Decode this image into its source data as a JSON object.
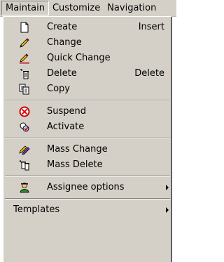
{
  "menubar": {
    "items": [
      {
        "label": "Maintain",
        "active": true
      },
      {
        "label": "Customize"
      },
      {
        "label": "Navigation"
      }
    ]
  },
  "menu": {
    "create": {
      "label": "Create",
      "shortcut": "Insert",
      "icon": "new-document-icon"
    },
    "change": {
      "label": "Change",
      "icon": "pencil-icon"
    },
    "quick_change": {
      "label": "Quick Change",
      "icon": "quick-change-icon"
    },
    "delete": {
      "label": "Delete",
      "shortcut": "Delete",
      "icon": "trash-icon"
    },
    "copy": {
      "label": "Copy",
      "icon": "copy-icon"
    },
    "suspend": {
      "label": "Suspend",
      "icon": "no-entry-icon"
    },
    "activate": {
      "label": "Activate",
      "icon": "activate-icon"
    },
    "mass_change": {
      "label": "Mass Change",
      "icon": "mass-change-icon"
    },
    "mass_delete": {
      "label": "Mass Delete",
      "icon": "mass-delete-icon"
    },
    "assignee_options": {
      "label": "Assignee options",
      "icon": "assignee-icon"
    },
    "templates": {
      "label": "Templates"
    }
  },
  "colors": {
    "menu_bg": "#d4d0c8",
    "separator": "#808080"
  }
}
